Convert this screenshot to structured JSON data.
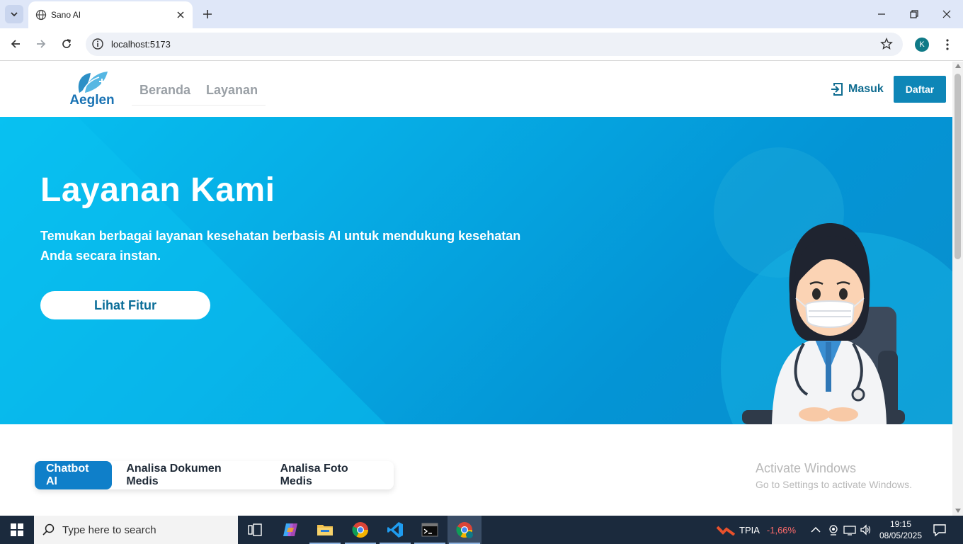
{
  "browser": {
    "tab_title": "Sano AI",
    "url": "localhost:5173",
    "profile_initial": "K"
  },
  "site": {
    "logo_text": "Aeglen",
    "nav": [
      "Beranda",
      "Layanan"
    ],
    "login_label": "Masuk",
    "register_label": "Daftar"
  },
  "hero": {
    "title": "Layanan Kami",
    "subtitle": "Temukan berbagai layanan kesehatan berbasis AI untuk mendukung kesehatan Anda secara instan.",
    "cta": "Lihat Fitur"
  },
  "feature_tabs": {
    "items": [
      "Chatbot AI",
      "Analisa Dokumen Medis",
      "Analisa Foto Medis"
    ],
    "active": "Chatbot AI"
  },
  "watermark": {
    "line1": "Activate Windows",
    "line2": "Go to Settings to activate Windows."
  },
  "taskbar": {
    "search_placeholder": "Type here to search",
    "stock_symbol": "TPIA",
    "stock_change": "-1,66%",
    "time": "19:15",
    "date": "08/05/2025"
  },
  "colors": {
    "brand_blue": "#0e86b7",
    "hero_start": "#06bff0",
    "hero_end": "#0a8ecc",
    "active_tab": "#0f7fc9"
  }
}
